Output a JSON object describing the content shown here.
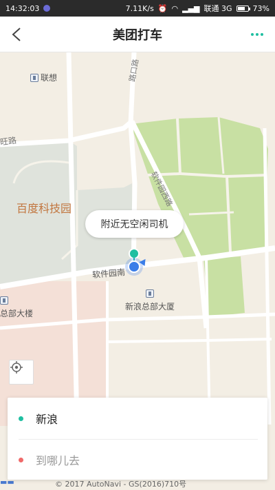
{
  "status_bar": {
    "time": "14:32:03",
    "network_speed": "7.11K/s",
    "carrier": "联通 3G",
    "battery": "73%",
    "battery_level": 0.73
  },
  "nav": {
    "title": "美团打车"
  },
  "map": {
    "labels": {
      "lianxiang": "联想",
      "road_top": "路口路",
      "road_left": "旺路",
      "baidu_park": "百度科技园",
      "road_diag": "软件园西路",
      "software_road": "软件园南",
      "sina_hq": "新浪总部大厦",
      "hq_building": "总部大楼"
    },
    "bubble_text": "附近无空闲司机",
    "copyright": "© 2017 AutoNavi - GS(2016)710号",
    "colors": {
      "park_green": "#c8e0a3",
      "campus_gray": "#dfe3dc",
      "pink_area": "#f4e0d7",
      "road": "#ffffff",
      "background": "#f3eee4"
    }
  },
  "trip": {
    "start_label": "新浪",
    "destination_placeholder": "到哪儿去",
    "start_color": "#1fbfa1",
    "dest_color": "#f06a6a"
  },
  "icons": {
    "back": "back-arrow-icon",
    "more": "more-dots-icon",
    "locate": "locate-target-icon"
  }
}
